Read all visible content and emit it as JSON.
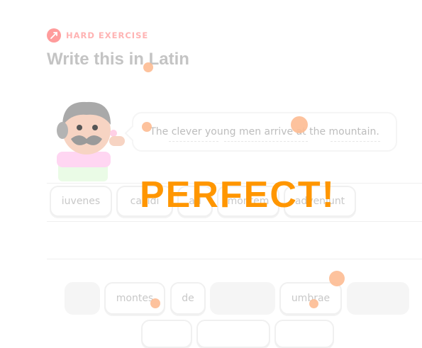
{
  "header": {
    "badge_label": "HARD EXERCISE",
    "badge_icon": "lightning-bolt-icon",
    "title": "Write this in Latin"
  },
  "prompt": {
    "sentence": "The clever young men arrive at the mountain."
  },
  "answer_chips": [
    {
      "label": "iuvenes"
    },
    {
      "label": "callidi"
    },
    {
      "label": "ad"
    },
    {
      "label": "montem"
    },
    {
      "label": "adveniunt"
    }
  ],
  "word_bank": [
    {
      "label": ""
    },
    {
      "label": "montes"
    },
    {
      "label": "de"
    },
    {
      "label": ""
    },
    {
      "label": "umbrae"
    },
    {
      "label": ""
    }
  ],
  "feedback": {
    "text": "PERFECT!"
  },
  "colors": {
    "accent_orange": "#ff9600",
    "badge_red": "#ff9c9c",
    "confetti": "#fdbb92"
  }
}
